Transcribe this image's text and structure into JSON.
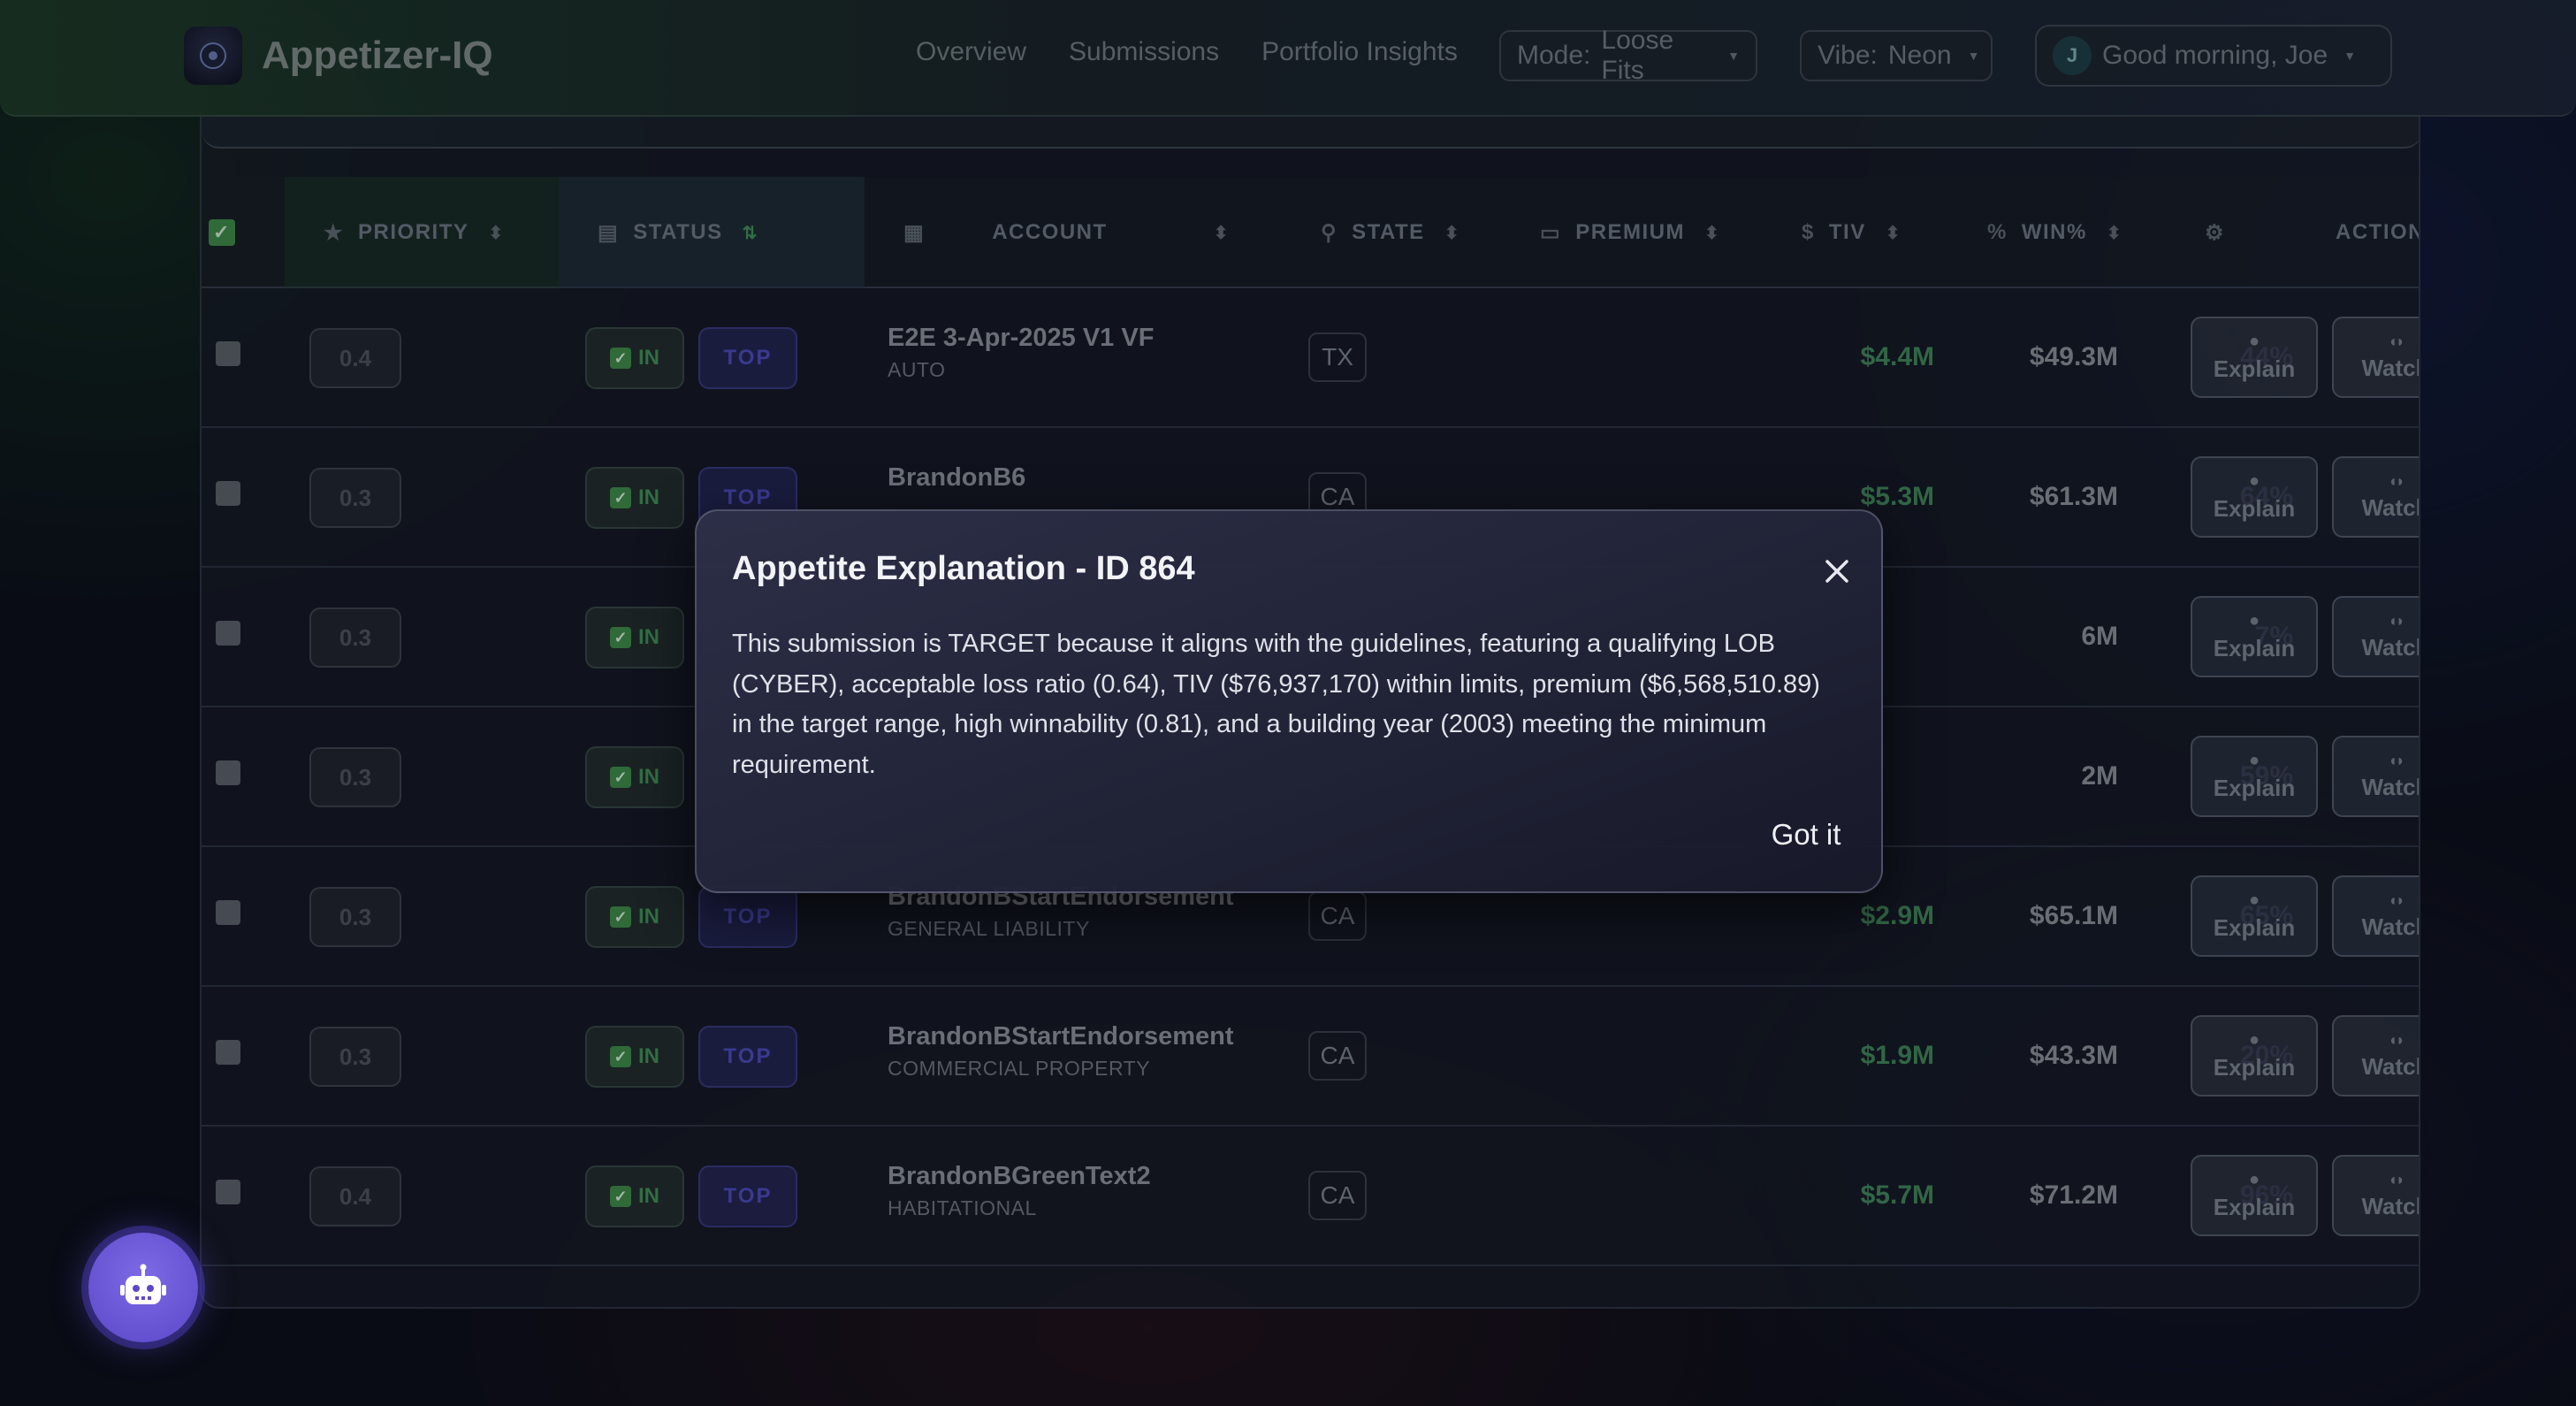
{
  "app": {
    "name": "Appetizer-IQ",
    "logo_icon": "app-logo-icon"
  },
  "nav": {
    "items": [
      "Overview",
      "Submissions",
      "Portfolio Insights"
    ]
  },
  "header": {
    "mode_label": "Mode:",
    "mode_value": "Loose Fits",
    "vibe_label": "Vibe:",
    "vibe_value": "Neon",
    "user_initial": "J",
    "greeting": "Good morning, Joe"
  },
  "table": {
    "columns": {
      "priority": "PRIORITY",
      "status": "STATUS",
      "account": "ACCOUNT",
      "state": "STATE",
      "premium": "PREMIUM",
      "tiv": "TIV",
      "win": "WIN%",
      "action": "ACTION"
    },
    "rows": [
      {
        "priority": "0.4",
        "in": "IN",
        "top": "TOP",
        "account": "E2E 3-Apr-2025 V1 VF",
        "lob": "AUTO",
        "state": "TX",
        "premium": "$4.4M",
        "tiv": "$49.3M",
        "win": "44%"
      },
      {
        "priority": "0.3",
        "in": "IN",
        "top": "TOP",
        "account": "BrandonB6",
        "lob": "",
        "state": "CA",
        "premium": "$5.3M",
        "tiv": "$61.3M",
        "win": "64%"
      },
      {
        "priority": "0.3",
        "in": "IN",
        "top": "",
        "account": "",
        "lob": "",
        "state": "",
        "premium": "",
        "tiv": "6M",
        "win": "7%"
      },
      {
        "priority": "0.3",
        "in": "IN",
        "top": "",
        "account": "",
        "lob": "",
        "state": "",
        "premium": "",
        "tiv": "2M",
        "win": "59%"
      },
      {
        "priority": "0.3",
        "in": "IN",
        "top": "TOP",
        "account": "BrandonBStartEndorsement",
        "lob": "GENERAL LIABILITY",
        "state": "CA",
        "premium": "$2.9M",
        "tiv": "$65.1M",
        "win": "65%"
      },
      {
        "priority": "0.3",
        "in": "IN",
        "top": "TOP",
        "account": "BrandonBStartEndorsement",
        "lob": "COMMERCIAL PROPERTY",
        "state": "CA",
        "premium": "$1.9M",
        "tiv": "$43.3M",
        "win": "20%"
      },
      {
        "priority": "0.4",
        "in": "IN",
        "top": "TOP",
        "account": "BrandonBGreenText2",
        "lob": "HABITATIONAL",
        "state": "CA",
        "premium": "$5.7M",
        "tiv": "$71.2M",
        "win": "96%"
      }
    ],
    "explain_label": "Explain",
    "watch_label": "Watch"
  },
  "modal": {
    "title": "Appetite Explanation - ID 864",
    "body": "This submission is TARGET because it aligns with the guidelines, featuring a qualifying LOB (CYBER), acceptable loss ratio (0.64), TIV ($76,937,170) within limits, premium ($6,568,510.89) in the target range, high winnability (0.81), and a building year (2003) meeting the minimum requirement.",
    "ok_label": "Got it",
    "close_icon": "close-icon"
  },
  "colors": {
    "accent_green": "#3c8a45",
    "accent_purple": "#6a56d8",
    "premium_green": "#3f8556"
  }
}
